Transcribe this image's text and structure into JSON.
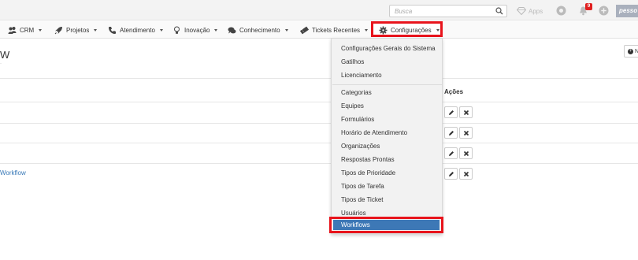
{
  "topbar": {
    "search_placeholder": "Busca",
    "apps_label": "Apps",
    "notification_count": "9",
    "user_label": "pesso"
  },
  "nav": {
    "items": [
      {
        "label": "CRM",
        "icon": "people-icon"
      },
      {
        "label": "Projetos",
        "icon": "rocket-icon"
      },
      {
        "label": "Atendimento",
        "icon": "phone-icon"
      },
      {
        "label": "Inovação",
        "icon": "lightbulb-icon"
      },
      {
        "label": "Conhecimento",
        "icon": "chat-icon"
      },
      {
        "label": "Tickets Recentes",
        "icon": "ticket-icon"
      },
      {
        "label": "Configurações",
        "icon": "gear-icon"
      }
    ]
  },
  "page": {
    "title": "W",
    "subtitle": "·",
    "new_button": "N",
    "actions_header": "Ações",
    "row_link": "Workflow"
  },
  "dropdown": {
    "group1": [
      "Configurações Gerais do Sistema",
      "Gatilhos",
      "Licenciamento"
    ],
    "group2": [
      "Categorias",
      "Equipes",
      "Formulários",
      "Horário de Atendimento",
      "Organizações",
      "Respostas Prontas",
      "Tipos de Prioridade",
      "Tipos de Tarefa",
      "Tipos de Ticket",
      "Usuários"
    ],
    "active": "Workflows"
  },
  "colors": {
    "highlight": "#e8141c",
    "active_item": "#3d78b6",
    "link": "#3a7ab8"
  }
}
